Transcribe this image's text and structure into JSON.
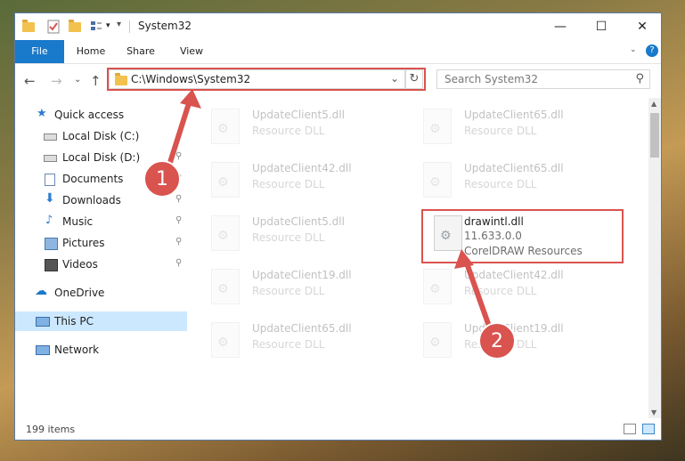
{
  "titlebar": {
    "title": "System32",
    "controls": {
      "minimize": "—",
      "maximize": "☐",
      "close": "✕"
    }
  },
  "ribbon": {
    "tabs": [
      {
        "label": "File"
      },
      {
        "label": "Home"
      },
      {
        "label": "Share"
      },
      {
        "label": "View"
      }
    ],
    "help": "?"
  },
  "navigation": {
    "back": "←",
    "forward": "→",
    "recent": "⌄",
    "up": "↑",
    "address": "C:\\Windows\\System32",
    "dropdown": "⌄",
    "refresh": "↻",
    "search_placeholder": "Search System32",
    "search_icon": "⚲"
  },
  "sidebar": {
    "items": [
      {
        "label": "Quick access",
        "icon": "star-icon"
      },
      {
        "label": "Local Disk (C:)",
        "icon": "drive-icon"
      },
      {
        "label": "Local Disk (D:)",
        "icon": "drive-icon",
        "pin": "📌"
      },
      {
        "label": "Documents",
        "icon": "documents-icon",
        "pin": "📌"
      },
      {
        "label": "Downloads",
        "icon": "downloads-icon",
        "pin": "📌"
      },
      {
        "label": "Music",
        "icon": "music-icon",
        "pin": "📌"
      },
      {
        "label": "Pictures",
        "icon": "pictures-icon",
        "pin": "📌"
      },
      {
        "label": "Videos",
        "icon": "videos-icon",
        "pin": "📌"
      },
      {
        "label": "OneDrive",
        "icon": "onedrive-icon"
      },
      {
        "label": "This PC",
        "icon": "pc-icon",
        "selected": true
      },
      {
        "label": "Network",
        "icon": "network-icon"
      }
    ]
  },
  "files": [
    {
      "name": "UpdateClient5.dll",
      "desc": "Resource DLL",
      "faded": true
    },
    {
      "name": "UpdateClient65.dll",
      "desc": "Resource DLL",
      "faded": true
    },
    {
      "name": "UpdateClient42.dll",
      "desc": "Resource DLL",
      "faded": true
    },
    {
      "name": "UpdateClient65.dll",
      "desc": "Resource DLL",
      "faded": true
    },
    {
      "name": "UpdateClient5.dll",
      "desc": "Resource DLL",
      "faded": true
    },
    {
      "name": "drawintl.dll",
      "version": "11.633.0.0",
      "desc": "CorelDRAW Resources",
      "faded": false
    },
    {
      "name": "UpdateClient19.dll",
      "desc": "Resource DLL",
      "faded": true
    },
    {
      "name": "UpdateClient42.dll",
      "desc": "Resource DLL",
      "faded": true
    },
    {
      "name": "UpdateClient65.dll",
      "desc": "Resource DLL",
      "faded": true
    },
    {
      "name": "UpdateClient19.dll",
      "desc": "Resource DLL",
      "faded": true
    }
  ],
  "status": {
    "count": "199 items"
  },
  "annotations": {
    "step1": "1",
    "step2": "2",
    "color": "#d9534f"
  }
}
